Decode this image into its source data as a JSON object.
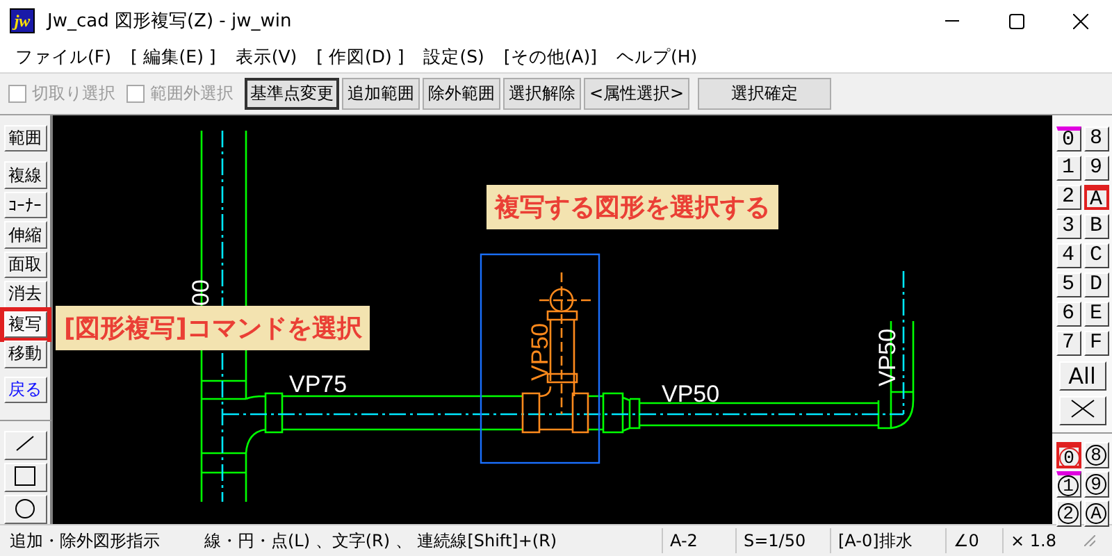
{
  "window": {
    "logo": "jw",
    "title": "Jw_cad 図形複写(Z) - jw_win"
  },
  "menu": [
    "ファイル(F)",
    "[ 編集(E) ]",
    "表示(V)",
    "[ 作図(D) ]",
    "設定(S)",
    "[その他(A)]",
    "ヘルプ(H)"
  ],
  "toolbar": {
    "checkboxes": [
      {
        "label": "切取り選択",
        "checked": false,
        "disabled": true
      },
      {
        "label": "範囲外選択",
        "checked": false,
        "disabled": true
      }
    ],
    "buttons": [
      {
        "label": "基準点変更",
        "default": true
      },
      {
        "label": "追加範囲",
        "default": false
      },
      {
        "label": "除外範囲",
        "default": false
      },
      {
        "label": "選択解除",
        "default": false
      },
      {
        "label": "<属性選択>",
        "default": false
      },
      {
        "label": "選択確定",
        "default": false,
        "kind": "wide"
      }
    ]
  },
  "tools": [
    {
      "label": "範囲",
      "selected": false,
      "kind": "command"
    },
    {
      "label": "複線",
      "selected": false,
      "kind": "command"
    },
    {
      "label": "ｺｰﾅｰ",
      "selected": false,
      "kind": "command"
    },
    {
      "label": "伸縮",
      "selected": false,
      "kind": "command"
    },
    {
      "label": "面取",
      "selected": false,
      "kind": "command"
    },
    {
      "label": "消去",
      "selected": false,
      "kind": "command"
    },
    {
      "label": "複写",
      "selected": true,
      "kind": "command"
    },
    {
      "label": "移動",
      "selected": false,
      "kind": "command"
    },
    {
      "label": "戻る",
      "selected": false,
      "kind": "undo"
    }
  ],
  "draw_tools": [
    {
      "kind": "line"
    },
    {
      "kind": "rectangle"
    },
    {
      "kind": "circle"
    }
  ],
  "canvas": {
    "pipe_labels": [
      {
        "text": "00",
        "kind": "vertical",
        "highlighted": false
      },
      {
        "text": "VP75",
        "kind": "horizontal",
        "highlighted": false
      },
      {
        "text": "VP50",
        "kind": "vertical",
        "highlighted": true
      },
      {
        "text": "VP50",
        "kind": "horizontal",
        "highlighted": false
      },
      {
        "text": "VP50",
        "kind": "vertical",
        "highlighted": false
      }
    ],
    "callouts": [
      {
        "text": "複写する図形を選択する"
      },
      {
        "text": "[図形複写]コマンドを選択"
      }
    ]
  },
  "layers": [
    {
      "label": "0",
      "selected": false,
      "marked": true
    },
    {
      "label": "8",
      "selected": false,
      "marked": false
    },
    {
      "label": "1",
      "selected": false,
      "marked": false
    },
    {
      "label": "9",
      "selected": false,
      "marked": false
    },
    {
      "label": "2",
      "selected": false,
      "marked": false
    },
    {
      "label": "A",
      "selected": true,
      "marked": false
    },
    {
      "label": "3",
      "selected": false,
      "marked": false
    },
    {
      "label": "B",
      "selected": false,
      "marked": false
    },
    {
      "label": "4",
      "selected": false,
      "marked": false
    },
    {
      "label": "C",
      "selected": false,
      "marked": false
    },
    {
      "label": "5",
      "selected": false,
      "marked": false
    },
    {
      "label": "D",
      "selected": false,
      "marked": false
    },
    {
      "label": "6",
      "selected": false,
      "marked": false
    },
    {
      "label": "E",
      "selected": false,
      "marked": false
    },
    {
      "label": "7",
      "selected": false,
      "marked": false
    },
    {
      "label": "F",
      "selected": false,
      "marked": false
    }
  ],
  "all_button": "All",
  "layer_groups": [
    {
      "label": "0",
      "selected": true,
      "marked": false
    },
    {
      "label": "8",
      "selected": false,
      "marked": false
    },
    {
      "label": "1",
      "selected": false,
      "marked": true
    },
    {
      "label": "9",
      "selected": false,
      "marked": false
    },
    {
      "label": "2",
      "selected": false,
      "marked": false
    },
    {
      "label": "A",
      "selected": false,
      "marked": false
    }
  ],
  "status": {
    "message": "追加・除外図形指示",
    "hint": "線・円・点(L) 、文字(R) 、 連続線[Shift]+(R)",
    "cells": [
      "A-2",
      "S=1/50",
      "[A-0]排水",
      "∠0",
      "× 1.8"
    ]
  }
}
